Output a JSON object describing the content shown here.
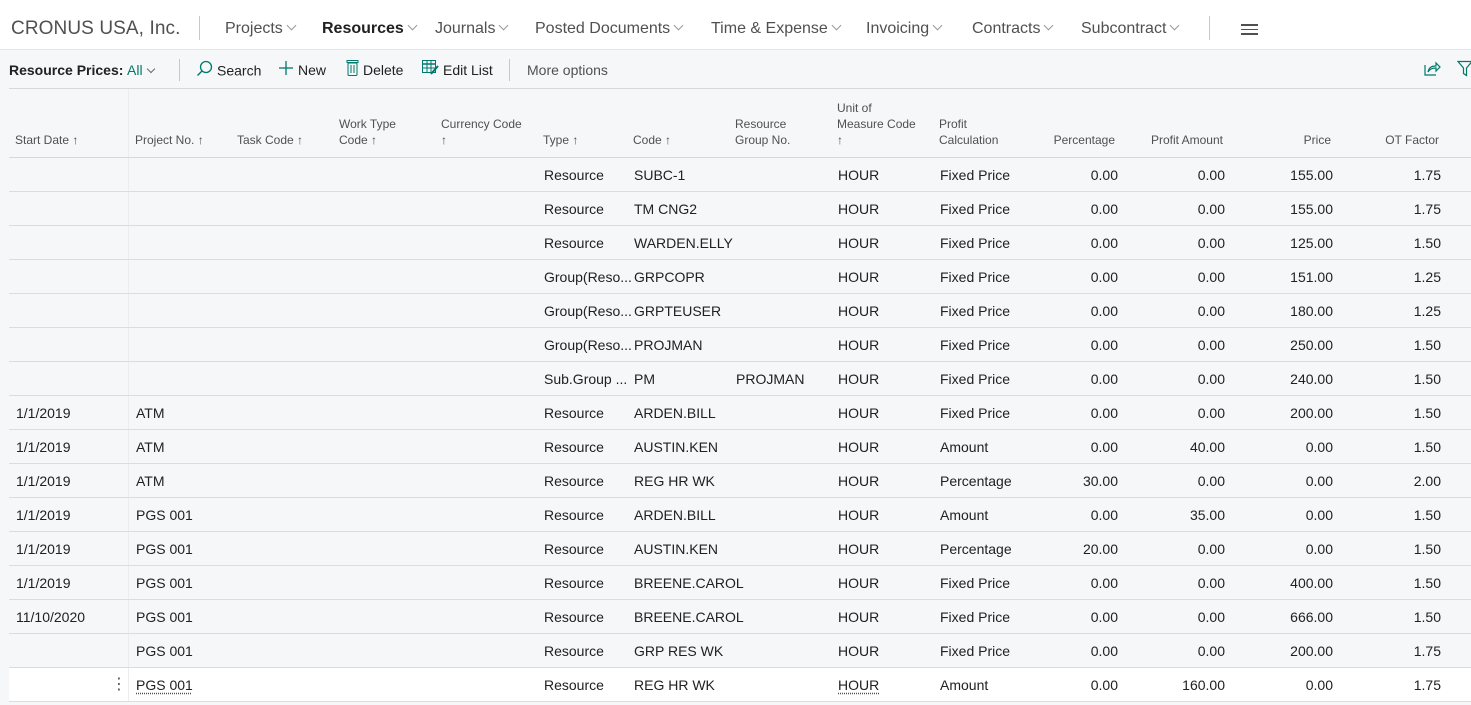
{
  "company": "CRONUS USA, Inc.",
  "nav": {
    "items": [
      {
        "label": "Projects",
        "active": false
      },
      {
        "label": "Resources",
        "active": true
      },
      {
        "label": "Journals",
        "active": false
      },
      {
        "label": "Posted Documents",
        "active": false
      },
      {
        "label": "Time & Expense",
        "active": false
      },
      {
        "label": "Invoicing",
        "active": false
      },
      {
        "label": "Contracts",
        "active": false
      },
      {
        "label": "Subcontract",
        "active": false
      }
    ],
    "menu_icon": "hamburger-icon"
  },
  "actionbar": {
    "title": "Resource Prices:",
    "filter": "All",
    "search": "Search",
    "new": "New",
    "delete": "Delete",
    "edit_list": "Edit List",
    "more_options": "More options",
    "icons": {
      "search": "search-icon",
      "new": "plus-icon",
      "delete": "trash-icon",
      "edit_list": "edit-list-icon",
      "share": "share-icon",
      "filter": "filter-icon"
    }
  },
  "accent_color": "#00796b",
  "table": {
    "columns": {
      "start_date": "Start Date ↑",
      "project_no": "Project No. ↑",
      "task_code": "Task Code ↑",
      "work_type_1": "Work Type",
      "work_type_2": "Code ↑",
      "currency_1": "Currency Code",
      "currency_2": "↑",
      "type": "Type ↑",
      "code": "Code ↑",
      "res_group_1": "Resource",
      "res_group_2": "Group No.",
      "uom_1": "Unit of",
      "uom_2": "Measure Code",
      "uom_3": "↑",
      "profit_calc_1": "Profit",
      "profit_calc_2": "Calculation",
      "percentage": "Percentage",
      "profit_amount": "Profit Amount",
      "price": "Price",
      "ot_factor": "OT Factor"
    },
    "rows": [
      {
        "start_date": "",
        "project_no": "",
        "type": "Resource",
        "code": "SUBC-1",
        "res_group": "",
        "uom": "HOUR",
        "profit_calc": "Fixed Price",
        "percentage": "0.00",
        "profit_amount": "0.00",
        "price": "155.00",
        "ot_factor": "1.75"
      },
      {
        "start_date": "",
        "project_no": "",
        "type": "Resource",
        "code": "TM CNG2",
        "res_group": "",
        "uom": "HOUR",
        "profit_calc": "Fixed Price",
        "percentage": "0.00",
        "profit_amount": "0.00",
        "price": "155.00",
        "ot_factor": "1.75"
      },
      {
        "start_date": "",
        "project_no": "",
        "type": "Resource",
        "code": "WARDEN.ELLY",
        "res_group": "",
        "uom": "HOUR",
        "profit_calc": "Fixed Price",
        "percentage": "0.00",
        "profit_amount": "0.00",
        "price": "125.00",
        "ot_factor": "1.50"
      },
      {
        "start_date": "",
        "project_no": "",
        "type": "Group(Reso...",
        "code": "GRPCOPR",
        "res_group": "",
        "uom": "HOUR",
        "profit_calc": "Fixed Price",
        "percentage": "0.00",
        "profit_amount": "0.00",
        "price": "151.00",
        "ot_factor": "1.25"
      },
      {
        "start_date": "",
        "project_no": "",
        "type": "Group(Reso...",
        "code": "GRPTEUSER",
        "res_group": "",
        "uom": "HOUR",
        "profit_calc": "Fixed Price",
        "percentage": "0.00",
        "profit_amount": "0.00",
        "price": "180.00",
        "ot_factor": "1.25"
      },
      {
        "start_date": "",
        "project_no": "",
        "type": "Group(Reso...",
        "code": "PROJMAN",
        "res_group": "",
        "uom": "HOUR",
        "profit_calc": "Fixed Price",
        "percentage": "0.00",
        "profit_amount": "0.00",
        "price": "250.00",
        "ot_factor": "1.50"
      },
      {
        "start_date": "",
        "project_no": "",
        "type": "Sub.Group ...",
        "code": "PM",
        "res_group": "PROJMAN",
        "uom": "HOUR",
        "profit_calc": "Fixed Price",
        "percentage": "0.00",
        "profit_amount": "0.00",
        "price": "240.00",
        "ot_factor": "1.50"
      },
      {
        "start_date": "1/1/2019",
        "project_no": "ATM",
        "type": "Resource",
        "code": "ARDEN.BILL",
        "res_group": "",
        "uom": "HOUR",
        "profit_calc": "Fixed Price",
        "percentage": "0.00",
        "profit_amount": "0.00",
        "price": "200.00",
        "ot_factor": "1.50"
      },
      {
        "start_date": "1/1/2019",
        "project_no": "ATM",
        "type": "Resource",
        "code": "AUSTIN.KEN",
        "res_group": "",
        "uom": "HOUR",
        "profit_calc": "Amount",
        "percentage": "0.00",
        "profit_amount": "40.00",
        "price": "0.00",
        "ot_factor": "1.50"
      },
      {
        "start_date": "1/1/2019",
        "project_no": "ATM",
        "type": "Resource",
        "code": "REG HR WK",
        "res_group": "",
        "uom": "HOUR",
        "profit_calc": "Percentage",
        "percentage": "30.00",
        "profit_amount": "0.00",
        "price": "0.00",
        "ot_factor": "2.00"
      },
      {
        "start_date": "1/1/2019",
        "project_no": "PGS 001",
        "type": "Resource",
        "code": "ARDEN.BILL",
        "res_group": "",
        "uom": "HOUR",
        "profit_calc": "Amount",
        "percentage": "0.00",
        "profit_amount": "35.00",
        "price": "0.00",
        "ot_factor": "1.50"
      },
      {
        "start_date": "1/1/2019",
        "project_no": "PGS 001",
        "type": "Resource",
        "code": "AUSTIN.KEN",
        "res_group": "",
        "uom": "HOUR",
        "profit_calc": "Percentage",
        "percentage": "20.00",
        "profit_amount": "0.00",
        "price": "0.00",
        "ot_factor": "1.50"
      },
      {
        "start_date": "1/1/2019",
        "project_no": "PGS 001",
        "type": "Resource",
        "code": "BREENE.CAROL",
        "res_group": "",
        "uom": "HOUR",
        "profit_calc": "Fixed Price",
        "percentage": "0.00",
        "profit_amount": "0.00",
        "price": "400.00",
        "ot_factor": "1.50"
      },
      {
        "start_date": "11/10/2020",
        "project_no": "PGS 001",
        "type": "Resource",
        "code": "BREENE.CAROL",
        "res_group": "",
        "uom": "HOUR",
        "profit_calc": "Fixed Price",
        "percentage": "0.00",
        "profit_amount": "0.00",
        "price": "666.00",
        "ot_factor": "1.50"
      },
      {
        "start_date": "",
        "project_no": "PGS 001",
        "type": "Resource",
        "code": "GRP RES WK",
        "res_group": "",
        "uom": "HOUR",
        "profit_calc": "Fixed Price",
        "percentage": "0.00",
        "profit_amount": "0.00",
        "price": "200.00",
        "ot_factor": "1.75"
      },
      {
        "start_date": "",
        "project_no": "PGS 001",
        "type": "Resource",
        "code": "REG HR WK",
        "res_group": "",
        "uom": "HOUR",
        "profit_calc": "Amount",
        "percentage": "0.00",
        "profit_amount": "160.00",
        "price": "0.00",
        "ot_factor": "1.75",
        "selected": true,
        "row_menu": "⋮"
      }
    ]
  }
}
